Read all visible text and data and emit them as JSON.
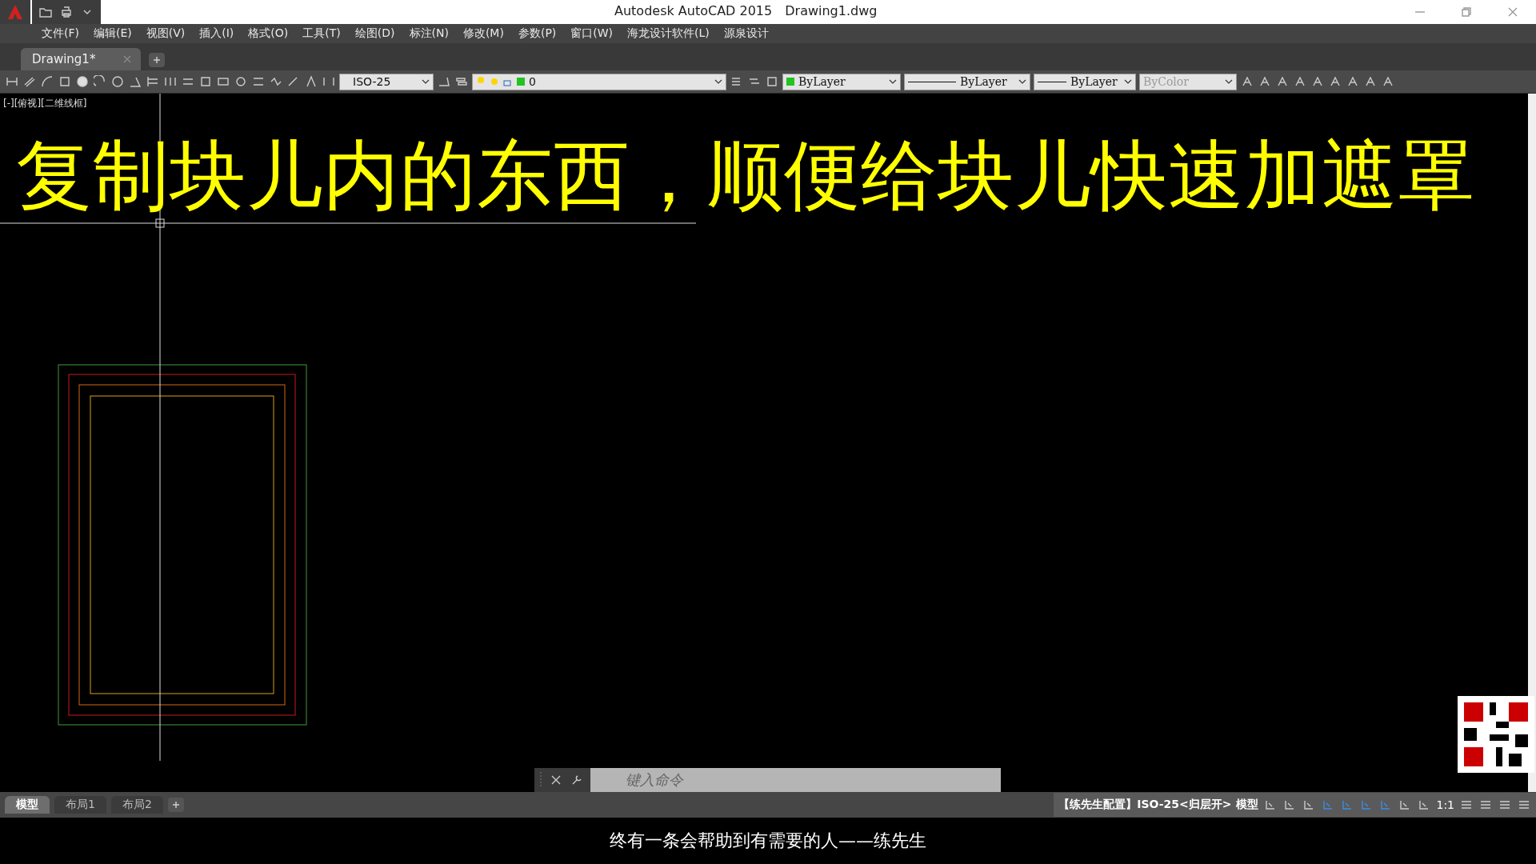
{
  "title_bar": {
    "app": "Autodesk AutoCAD 2015",
    "file": "Drawing1.dwg"
  },
  "menu": [
    "文件(F)",
    "编辑(E)",
    "视图(V)",
    "插入(I)",
    "格式(O)",
    "工具(T)",
    "绘图(D)",
    "标注(N)",
    "修改(M)",
    "参数(P)",
    "窗口(W)",
    "海龙设计软件(L)",
    "源泉设计"
  ],
  "document_tabs": [
    {
      "label": "Drawing1*",
      "selected": true
    }
  ],
  "toolbar": {
    "dim_style": "ISO-25",
    "layer": "0",
    "color_control": "ByLayer",
    "linetype": "ByLayer",
    "lineweight": "ByLayer",
    "plot_style": "ByColor"
  },
  "viewport_label": "[-][俯视][二维线框]",
  "canvas_text": "复制块儿内的东西，顺便给块儿快速加遮罩",
  "command_line": {
    "placeholder": "键入命令"
  },
  "layout_tabs": [
    {
      "label": "模型",
      "selected": true
    },
    {
      "label": "布局1",
      "selected": false
    },
    {
      "label": "布局2",
      "selected": false
    }
  ],
  "status_bar": {
    "config": "【练先生配置】ISO-25<归层开>",
    "space": "模型",
    "scale": "1:1"
  },
  "caption": "终有一条会帮助到有需要的人——练先生"
}
